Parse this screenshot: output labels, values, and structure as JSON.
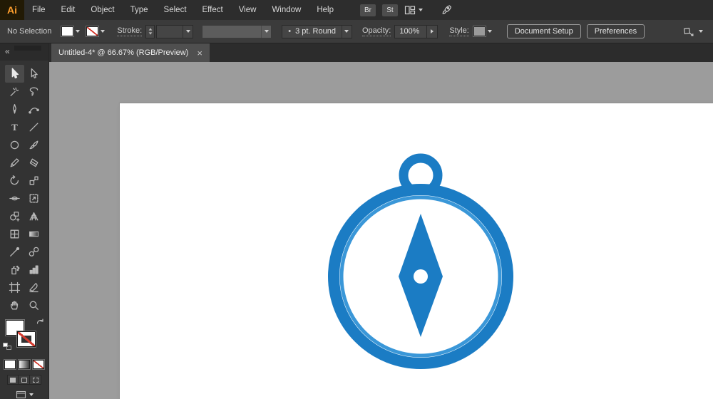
{
  "menu_bar": {
    "logo": "Ai",
    "menus": [
      "File",
      "Edit",
      "Object",
      "Type",
      "Select",
      "Effect",
      "View",
      "Window",
      "Help"
    ],
    "bridge_icon": "Br",
    "stock_icon": "St"
  },
  "control_bar": {
    "no_selection": "No Selection",
    "stroke_label": "Stroke:",
    "brush_dot": "•",
    "brush_name": "3 pt. Round",
    "opacity_label": "Opacity:",
    "opacity_value": "100%",
    "style_label": "Style:",
    "document_setup_button": "Document Setup",
    "preferences_button": "Preferences"
  },
  "document_tab": {
    "title": "Untitled-4* @ 66.67% (RGB/Preview)",
    "close": "×"
  },
  "tool_panel": {
    "collapse": "«",
    "tools": [
      {
        "name": "selection-tool",
        "active": true
      },
      {
        "name": "direct-selection-tool"
      },
      {
        "name": "magic-wand-tool"
      },
      {
        "name": "lasso-tool"
      },
      {
        "name": "pen-tool"
      },
      {
        "name": "curvature-tool"
      },
      {
        "name": "type-tool",
        "glyph": "T"
      },
      {
        "name": "line-segment-tool"
      },
      {
        "name": "ellipse-tool"
      },
      {
        "name": "paintbrush-tool"
      },
      {
        "name": "shaper-tool"
      },
      {
        "name": "eraser-tool"
      },
      {
        "name": "rotate-tool"
      },
      {
        "name": "scale-tool"
      },
      {
        "name": "width-tool"
      },
      {
        "name": "free-transform-tool"
      },
      {
        "name": "shape-builder-tool"
      },
      {
        "name": "perspective-grid-tool"
      },
      {
        "name": "mesh-tool"
      },
      {
        "name": "gradient-tool"
      },
      {
        "name": "eyedropper-tool"
      },
      {
        "name": "blend-tool"
      },
      {
        "name": "symbol-sprayer-tool"
      },
      {
        "name": "column-graph-tool"
      },
      {
        "name": "artboard-tool"
      },
      {
        "name": "slice-tool"
      },
      {
        "name": "hand-tool"
      },
      {
        "name": "zoom-tool"
      }
    ]
  },
  "canvas": {
    "pasteboard_color": "#9c9c9c",
    "artboard_color": "#ffffff",
    "icon": {
      "type": "compass",
      "ring_color": "#1b7cc4",
      "ring_highlight_color": "#3a97d8",
      "needle_color": "#1b7cc4",
      "center_dot_color": "#ffffff",
      "loop_color": "#1b7cc4"
    }
  }
}
